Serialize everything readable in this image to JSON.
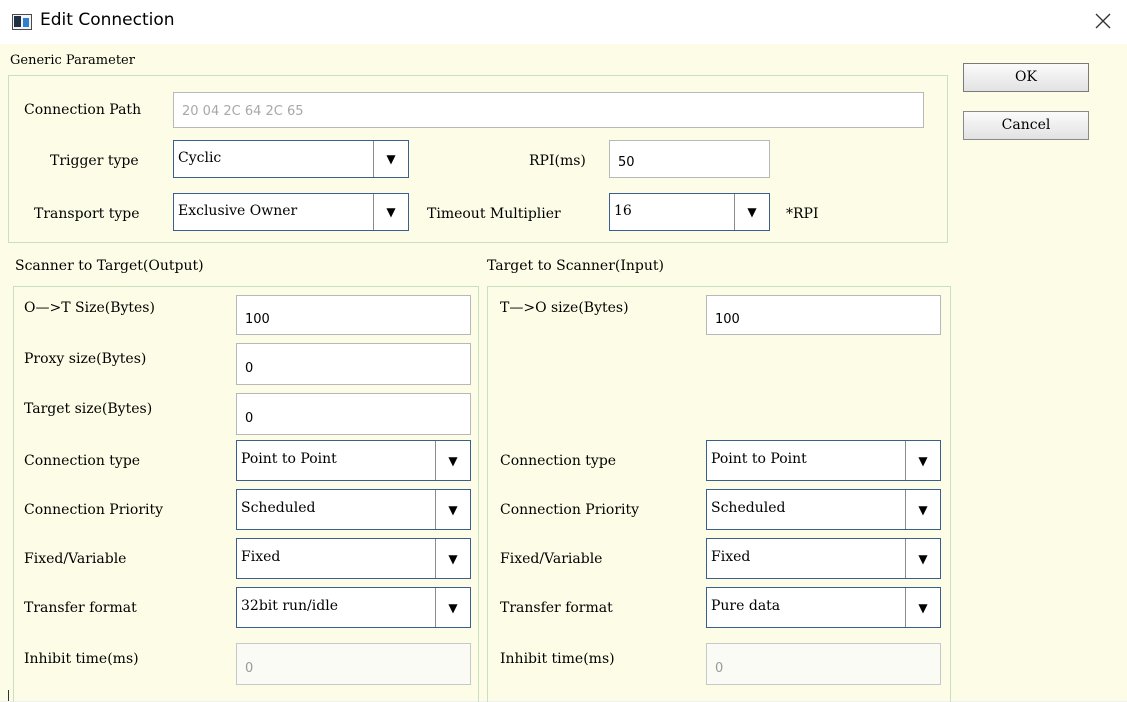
{
  "window": {
    "title": "Edit Connection"
  },
  "buttons": {
    "ok": "OK",
    "cancel": "Cancel"
  },
  "generic": {
    "heading": "Generic Parameter",
    "connection_path_label": "Connection Path",
    "connection_path_value": "20 04 2C 64 2C 65",
    "trigger_type_label": "Trigger type",
    "trigger_type_value": "Cyclic",
    "rpi_label": "RPI(ms)",
    "rpi_value": "50",
    "transport_type_label": "Transport type",
    "transport_type_value": "Exclusive Owner",
    "timeout_multiplier_label": "Timeout Multiplier",
    "timeout_multiplier_value": "16",
    "rpi_suffix": "*RPI"
  },
  "output": {
    "heading": "Scanner to Target(Output)",
    "size_label": "O—>T Size(Bytes)",
    "size_value": "100",
    "proxy_label": "Proxy size(Bytes)",
    "proxy_value": "0",
    "target_label": "Target size(Bytes)",
    "target_value": "0",
    "connection_type_label": "Connection type",
    "connection_type_value": "Point to Point",
    "priority_label": "Connection Priority",
    "priority_value": "Scheduled",
    "fixed_label": "Fixed/Variable",
    "fixed_value": "Fixed",
    "format_label": "Transfer format",
    "format_value": "32bit run/idle",
    "inhibit_label": "Inhibit time(ms)",
    "inhibit_value": "0"
  },
  "input": {
    "heading": "Target to Scanner(Input)",
    "size_label": "T—>O size(Bytes)",
    "size_value": "100",
    "connection_type_label": "Connection type",
    "connection_type_value": "Point to Point",
    "priority_label": "Connection Priority",
    "priority_value": "Scheduled",
    "fixed_label": "Fixed/Variable",
    "fixed_value": "Fixed",
    "format_label": "Transfer format",
    "format_value": "Pure data",
    "inhibit_label": "Inhibit time(ms)",
    "inhibit_value": "0"
  },
  "icons": {
    "app": "window-app-icon",
    "close": "close-icon",
    "dropdown": "dropdown-arrow-icon"
  },
  "colors": {
    "client_background": "#fdfde7",
    "group_border": "#c9e0bf",
    "combo_border": "#3a5f8e"
  }
}
